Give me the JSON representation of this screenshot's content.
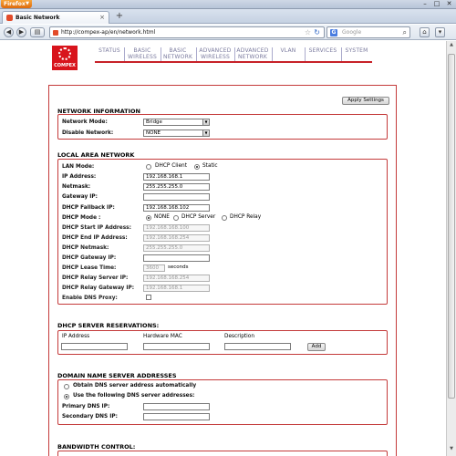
{
  "browser": {
    "app_button": "Firefox",
    "tab_title": "Basic Network",
    "url": "http://compex-ap/en/network.html",
    "search_placeholder": "Google",
    "search_engine_glyph": "G",
    "win_min": "–",
    "win_max": "□",
    "win_close": "✕"
  },
  "router": {
    "logo_text": "COMPEX",
    "menu": [
      {
        "line1": "STATUS",
        "line2": ""
      },
      {
        "line1": "BASIC",
        "line2": "WIRELESS"
      },
      {
        "line1": "BASIC",
        "line2": "NETWORK"
      },
      {
        "line1": "ADVANCED",
        "line2": "WIRELESS"
      },
      {
        "line1": "ADVANCED",
        "line2": "NETWORK"
      },
      {
        "line1": "VLAN",
        "line2": ""
      },
      {
        "line1": "SERVICES",
        "line2": ""
      },
      {
        "line1": "SYSTEM",
        "line2": ""
      }
    ],
    "accent_color": "#c72128"
  },
  "apply_button": "Apply Settings",
  "network_info": {
    "title": "NETWORK INFORMATION",
    "mode_label": "Network Mode:",
    "mode_value": "Bridge",
    "disable_label": "Disable Network:",
    "disable_value": "NONE"
  },
  "lan": {
    "title": "LOCAL AREA NETWORK",
    "lan_mode_label": "LAN Mode:",
    "lan_mode_options": [
      "DHCP Client",
      "Static"
    ],
    "lan_mode_selected": "Static",
    "ip_label": "IP Address:",
    "ip_value": "192.168.168.1",
    "netmask_label": "Netmask:",
    "netmask_value": "255.255.255.0",
    "gateway_label": "Gateway IP:",
    "gateway_value": "",
    "fallback_label": "DHCP Fallback IP:",
    "fallback_value": "192.168.168.102",
    "dhcp_mode_label": "DHCP Mode :",
    "dhcp_mode_options": [
      "NONE",
      "DHCP Server",
      "DHCP Relay"
    ],
    "dhcp_mode_selected": "NONE",
    "start_label": "DHCP Start IP Address:",
    "start_value": "192.168.168.100",
    "end_label": "DHCP End IP Address:",
    "end_value": "192.168.168.254",
    "dhcp_netmask_label": "DHCP Netmask:",
    "dhcp_netmask_value": "255.255.255.0",
    "dhcp_gateway_label": "DHCP Gateway IP:",
    "dhcp_gateway_value": "",
    "lease_label": "DHCP Lease Time:",
    "lease_value": "3600",
    "lease_unit": "seconds",
    "relay_server_label": "DHCP Relay Server IP:",
    "relay_server_value": "192.168.168.254",
    "relay_gateway_label": "DHCP Relay Gateway IP:",
    "relay_gateway_value": "192.168.168.1",
    "dns_proxy_label": "Enable DNS Proxy:"
  },
  "reservations": {
    "title": "DHCP SERVER RESERVATIONS:",
    "columns": [
      "IP Address",
      "Hardware MAC",
      "Description"
    ],
    "add_button": "Add"
  },
  "dns": {
    "title": "DOMAIN NAME SERVER ADDRESSES",
    "auto_option": "Obtain DNS server address automatically",
    "manual_option": "Use the following DNS server addresses:",
    "selected": "manual",
    "primary_label": "Primary DNS IP:",
    "secondary_label": "Secondary DNS IP:"
  },
  "bandwidth": {
    "title": "BANDWIDTH CONTROL:"
  }
}
